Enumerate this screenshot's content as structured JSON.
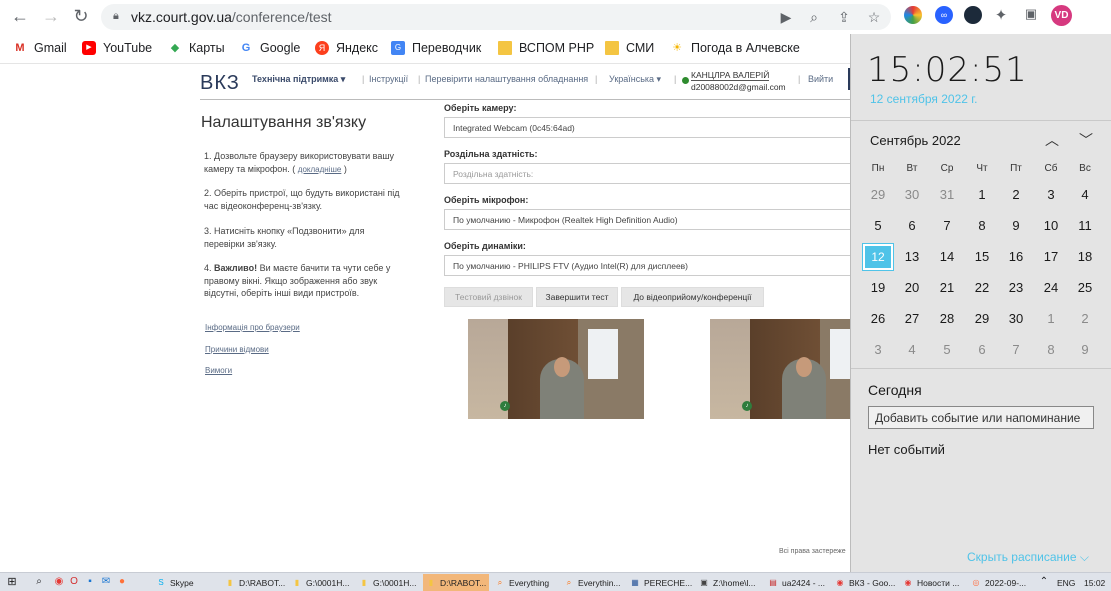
{
  "browser": {
    "url_host": "vkz.court.gov.ua",
    "url_path": "/conference/test",
    "profile_initials": "VD",
    "profile_color": "#d6397f",
    "bookmarks": [
      "Gmail",
      "YouTube",
      "Карты",
      "Google",
      "Яндекс",
      "Переводчик",
      "ВСПОМ РНР",
      "СМИ",
      "Погода в Алчевске"
    ]
  },
  "site": {
    "logo": "ВКЗ",
    "nav": {
      "support": "Технічна підтримка ▾",
      "instructions": "Інструкції",
      "check_settings": "Перевірити налаштування обладнання",
      "language": "Українська ▾",
      "user_name": "КАНЦЛРА ВАЛЕРІЙ",
      "user_email": "d20088002d@gmail.com",
      "logout": "Вийти"
    },
    "title": "Налаштування зв'язку",
    "steps": [
      {
        "n": "1.",
        "text": "Дозвольте браузеру використовувати вашу камеру та мікрофон. (",
        "link": "докладніше",
        "tail": ")"
      },
      {
        "n": "2.",
        "text": "Оберіть пристрої, що будуть використані під час відеоконференц-зв'язку."
      },
      {
        "n": "3.",
        "text": "Натисніть кнопку «Подзвонити» для перевірки зв'язку."
      },
      {
        "n": "4.",
        "bold": "Важливо!",
        "text": "Ви маєте бачити та чути себе у правому вікні. Якщо зображення або звук відсутні, оберіть інші види пристроїв."
      }
    ],
    "links": [
      "Інформація про браузери",
      "Причини відмови",
      "Вимоги"
    ],
    "fields": {
      "camera_label": "Оберіть камеру:",
      "camera_value": "Integrated Webcam (0c45:64ad)",
      "resolution_label": "Роздільна здатність:",
      "resolution_placeholder": "Роздільна здатність:",
      "mic_label": "Оберіть мікрофон:",
      "mic_value": "По умолчанию - Микрофон (Realtek High Definition Audio)",
      "speaker_label": "Оберіть динаміки:",
      "speaker_value": "По умолчанию - PHILIPS FTV (Аудио Intel(R) для дисплеев)"
    },
    "buttons": {
      "test_call": "Тестовий дзвінок",
      "end_test": "Завершити тест",
      "to_video": "До відеоприйому/конференції"
    },
    "footer": "Всі права застереже"
  },
  "calendar": {
    "time": "15:02:51",
    "date": "12 сентября 2022 г.",
    "month": "Сентябрь 2022",
    "weekdays": [
      "Пн",
      "Вт",
      "Ср",
      "Чт",
      "Пт",
      "Сб",
      "Вс"
    ],
    "weeks": [
      [
        "29",
        "30",
        "31",
        "1",
        "2",
        "3",
        "4"
      ],
      [
        "5",
        "6",
        "7",
        "8",
        "9",
        "10",
        "11"
      ],
      [
        "12",
        "13",
        "14",
        "15",
        "16",
        "17",
        "18"
      ],
      [
        "19",
        "20",
        "21",
        "22",
        "23",
        "24",
        "25"
      ],
      [
        "26",
        "27",
        "28",
        "29",
        "30",
        "1",
        "2"
      ],
      [
        "3",
        "4",
        "5",
        "6",
        "7",
        "8",
        "9"
      ]
    ],
    "today_label": "Сегодня",
    "add_event_placeholder": "Добавить событие или напоминание",
    "no_events": "Нет событий",
    "hide_schedule": "Скрыть расписание ⌵",
    "accent_color": "#4fc3e8"
  },
  "taskbar": {
    "items": [
      "Skype",
      "D:\\RABOT...",
      "G:\\0001H...",
      "G:\\0001H...",
      "D:\\RABOT...",
      "Everything",
      "Everythin...",
      "PERECHE...",
      "Z:\\home\\l...",
      "ua2424 - ...",
      "ВКЗ - Goo...",
      "Новости ...",
      "2022-09-..."
    ],
    "active_index": 4,
    "language": "ENG",
    "time": "15:02"
  }
}
